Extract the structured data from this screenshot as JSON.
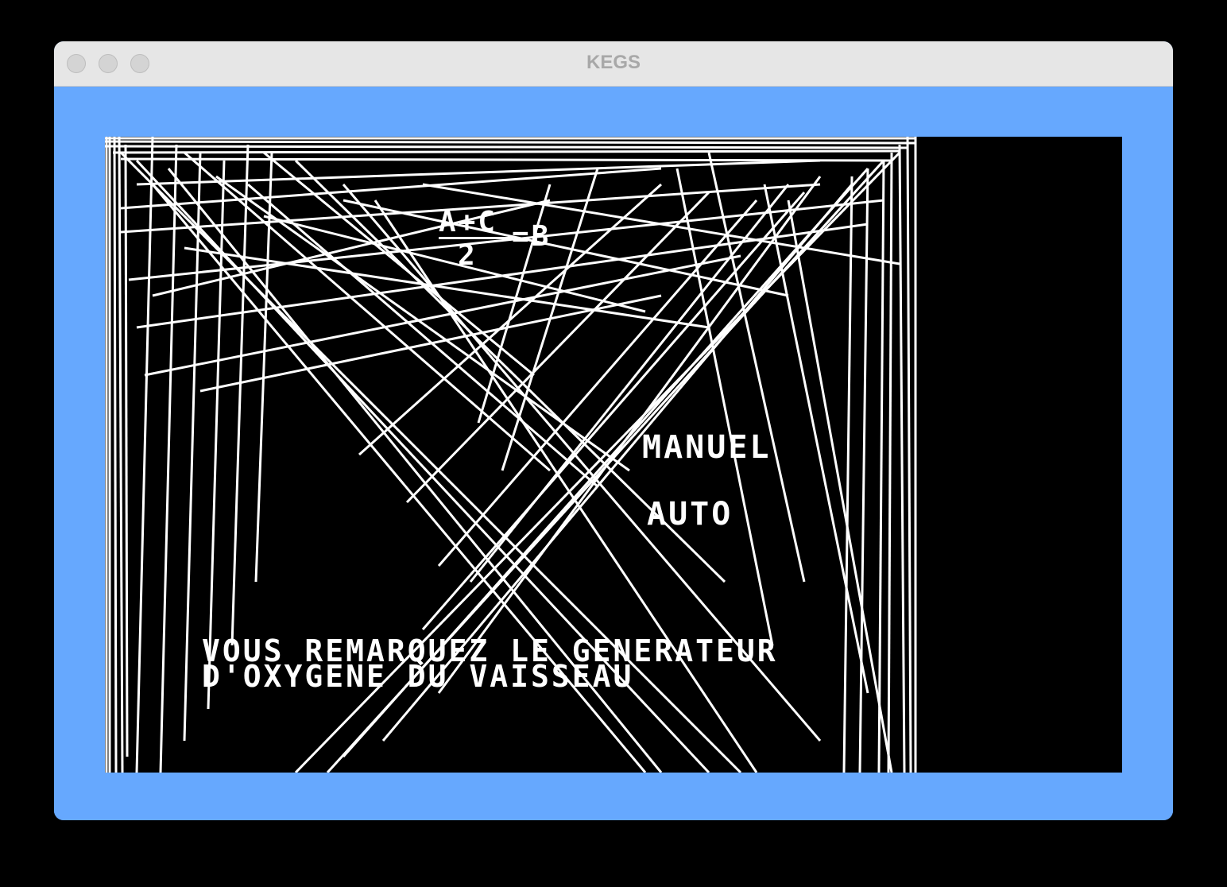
{
  "window": {
    "title": "KEGS"
  },
  "game": {
    "formula": {
      "numerator": "A+C",
      "denominator": "2",
      "result": "=B"
    },
    "options": {
      "manuel": "MANUEL",
      "auto": "AUTO"
    },
    "message": {
      "line1": "VOUS REMARQUEZ LE GENERATEUR",
      "line2": "D'OXYGENE DU VAISSEAU"
    }
  },
  "colors": {
    "window_background": "#66a8fe",
    "screen_background": "#000000",
    "graphics": "#ffffff",
    "titlebar": "#e6e6e6"
  }
}
